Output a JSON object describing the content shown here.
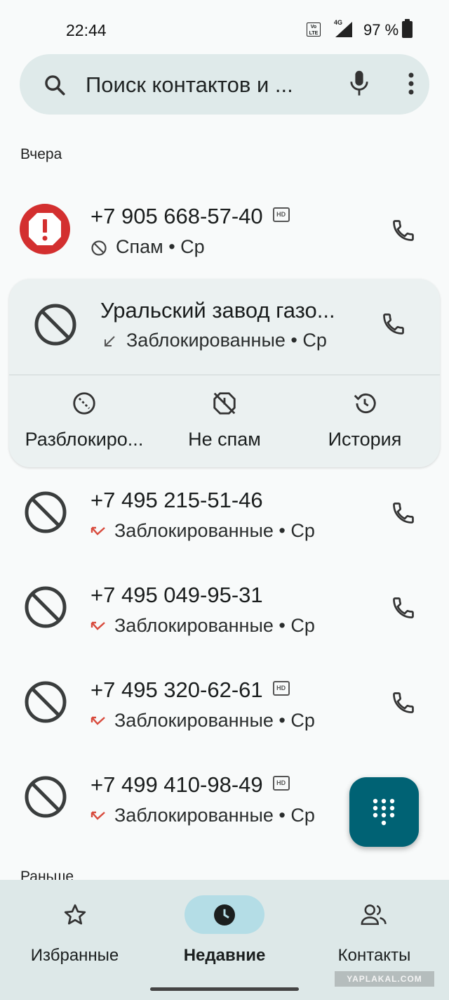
{
  "status_bar": {
    "time": "22:44",
    "volte": "Vo LTE",
    "network": "4G",
    "battery": "97 %"
  },
  "search": {
    "placeholder": "Поиск контактов и ..."
  },
  "section_yesterday": "Вчера",
  "section_earlier": "Раньше",
  "calls": [
    {
      "number": "+7 905 668-57-40",
      "hd": "HD",
      "status": "Спам • Ср"
    },
    {
      "number": "+7 495 215-51-46",
      "status": "Заблокированные • Ср"
    },
    {
      "number": "+7 495 049-95-31",
      "status": "Заблокированные • Ср"
    },
    {
      "number": "+7 495 320-62-61",
      "hd": "HD",
      "status": "Заблокированные • Ср"
    },
    {
      "number": "+7 499 410-98-49",
      "hd": "HD",
      "status": "Заблокированные • Ср"
    }
  ],
  "expanded_card": {
    "name": "Уральский завод газо...",
    "status": "Заблокированные • Ср",
    "actions": {
      "unblock": "Разблокиро...",
      "not_spam": "Не спам",
      "history": "История"
    }
  },
  "bottom_nav": {
    "favorites": "Избранные",
    "recents": "Недавние",
    "contacts": "Контакты"
  },
  "watermark": "YAPLAKAL.COM",
  "colors": {
    "accent": "#006274",
    "spam_red": "#d32f2f",
    "card_bg": "#ebf1f1",
    "nav_bg": "#dde8e8",
    "missed_red": "#d84a3c"
  }
}
